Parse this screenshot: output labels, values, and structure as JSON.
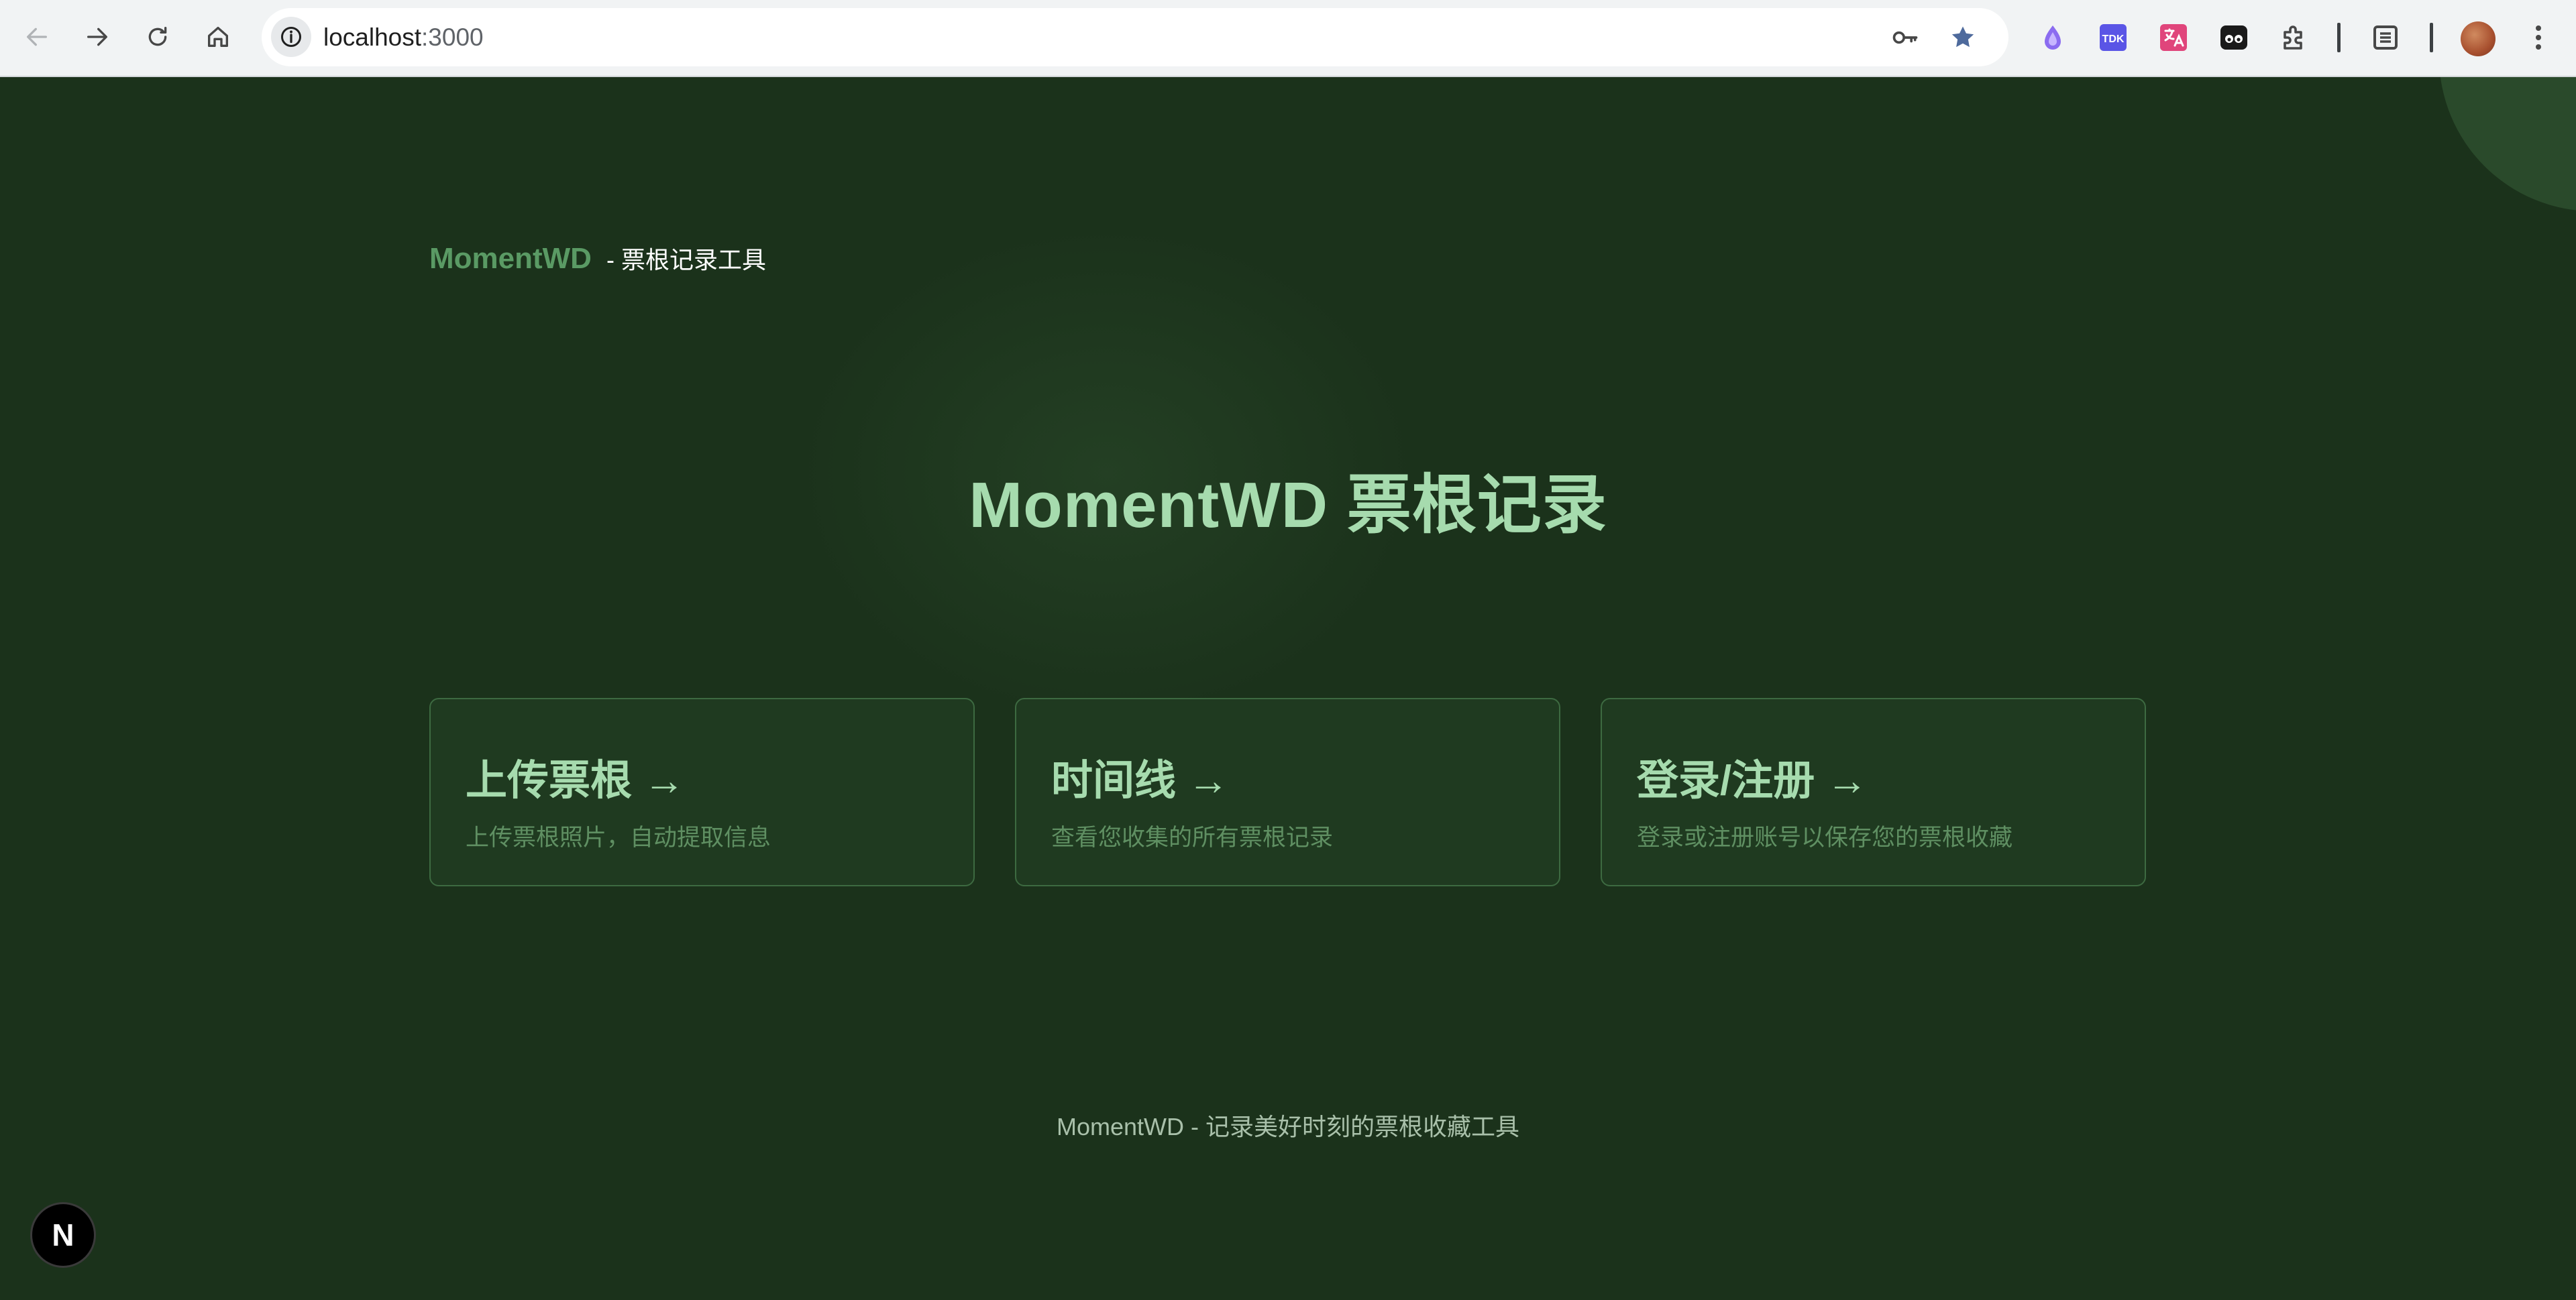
{
  "browser": {
    "url_host": "localhost",
    "url_port": ":3000",
    "icons": {
      "back": "back-arrow-icon",
      "forward": "forward-arrow-icon",
      "reload": "reload-icon",
      "home": "home-icon",
      "site_info": "info-icon",
      "password": "key-icon",
      "bookmark": "star-icon",
      "extensions": [
        "bird-extension-icon",
        "tdk-extension-icon",
        "translate-extension-icon",
        "mask-extension-icon",
        "puzzle-extensions-icon"
      ],
      "reading_list": "side-panel-icon",
      "menu": "kebab-menu-icon"
    },
    "tdk_label": "TDK"
  },
  "header": {
    "brand_name": "MomentWD",
    "brand_sub": "- 票根记录工具"
  },
  "hero": {
    "title": "MomentWD 票根记录"
  },
  "cards": [
    {
      "title": "上传票根 →",
      "desc": "上传票根照片，自动提取信息"
    },
    {
      "title": "时间线 →",
      "desc": "查看您收集的所有票根记录"
    },
    {
      "title": "登录/注册 →",
      "desc": "登录或注册账号以保存您的票根收藏"
    }
  ],
  "footer": {
    "text": "MomentWD - 记录美好时刻的票根收藏工具"
  },
  "dev_badge": {
    "label": "N"
  },
  "colors": {
    "page_bg": "#1b321b",
    "accent": "#a6dbae",
    "brand": "#5a9a64",
    "card_bg": "#1f3a20",
    "card_border": "#3d6a41"
  }
}
